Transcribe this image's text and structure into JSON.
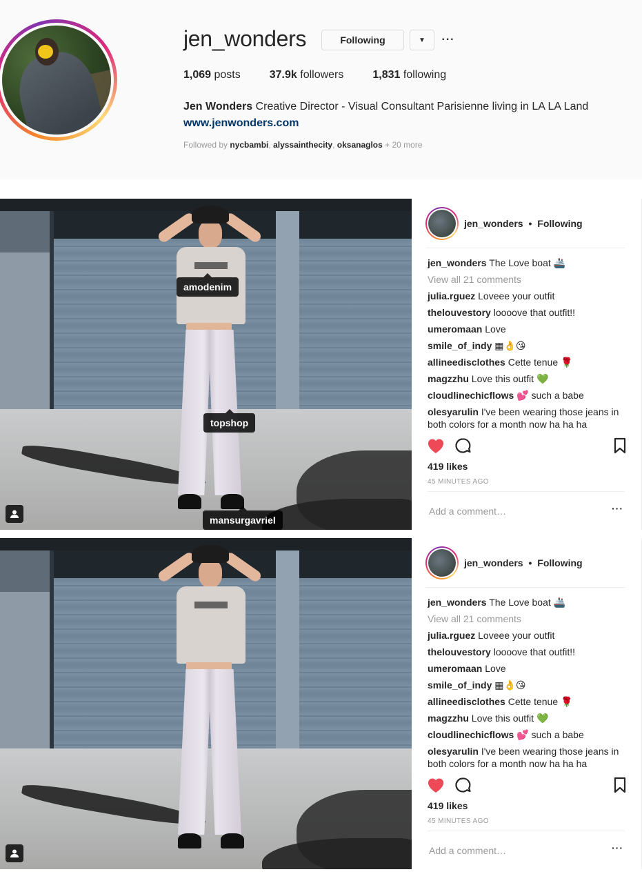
{
  "profile": {
    "username": "jen_wonders",
    "following_button": "Following",
    "dropdown_icon": "caret-down-icon",
    "more_icon": "ellipsis-icon",
    "more_label": "···",
    "stats": {
      "posts_count": "1,069",
      "posts_label": "posts",
      "followers_count": "37.9k",
      "followers_label": "followers",
      "following_count": "1,831",
      "following_label": "following"
    },
    "full_name": "Jen Wonders",
    "bio": "Creative Director - Visual Consultant Parisienne living in LA LA Land",
    "website": "www.jenwonders.com",
    "followed_by_label": "Followed by",
    "followed_by_users": [
      "nycbambi",
      "alyssainthecity",
      "oksanaglos"
    ],
    "followed_by_more": "+ 20 more"
  },
  "posts": [
    {
      "tags": [
        "amodenim",
        "topshop",
        "mansurgavriel"
      ],
      "header_user": "jen_wonders",
      "header_dot": "•",
      "header_status": "Following",
      "caption_user": "jen_wonders",
      "caption_text": "The Love boat 🚢",
      "view_all": "View all 21 comments",
      "comments": [
        {
          "user": "julia.rguez",
          "text": "Loveee your outfit"
        },
        {
          "user": "thelouvestory",
          "text": "loooove that outfit!!"
        },
        {
          "user": "umeromaan",
          "text": "Love"
        },
        {
          "user": "smile_of_indy",
          "text": "▦👌😘"
        },
        {
          "user": "allineedisclothes",
          "text": "Cette tenue 🌹"
        },
        {
          "user": "magzzhu",
          "text": "Love this outfit 💚"
        },
        {
          "user": "cloudlinechicflows",
          "text": "💕 such a babe"
        },
        {
          "user": "olesyarulin",
          "text": "I've been wearing those jeans in both colors for a month now ha ha ha"
        }
      ],
      "likes": "419 likes",
      "time": "45 MINUTES AGO",
      "comment_placeholder": "Add a comment…",
      "comment_more": "···"
    },
    {
      "tags": [],
      "header_user": "jen_wonders",
      "header_dot": "•",
      "header_status": "Following",
      "caption_user": "jen_wonders",
      "caption_text": "The Love boat 🚢",
      "view_all": "View all 21 comments",
      "comments": [
        {
          "user": "julia.rguez",
          "text": "Loveee your outfit"
        },
        {
          "user": "thelouvestory",
          "text": "loooove that outfit!!"
        },
        {
          "user": "umeromaan",
          "text": "Love"
        },
        {
          "user": "smile_of_indy",
          "text": "▦👌😘"
        },
        {
          "user": "allineedisclothes",
          "text": "Cette tenue 🌹"
        },
        {
          "user": "magzzhu",
          "text": "Love this outfit 💚"
        },
        {
          "user": "cloudlinechicflows",
          "text": "💕 such a babe"
        },
        {
          "user": "olesyarulin",
          "text": "I've been wearing those jeans in both colors for a month now ha ha ha"
        }
      ],
      "likes": "419 likes",
      "time": "45 MINUTES AGO",
      "comment_placeholder": "Add a comment…",
      "comment_more": "···"
    }
  ],
  "colors": {
    "heart": "#ed4956",
    "link": "#003569",
    "muted": "#999999",
    "border": "#dbdbdb"
  }
}
